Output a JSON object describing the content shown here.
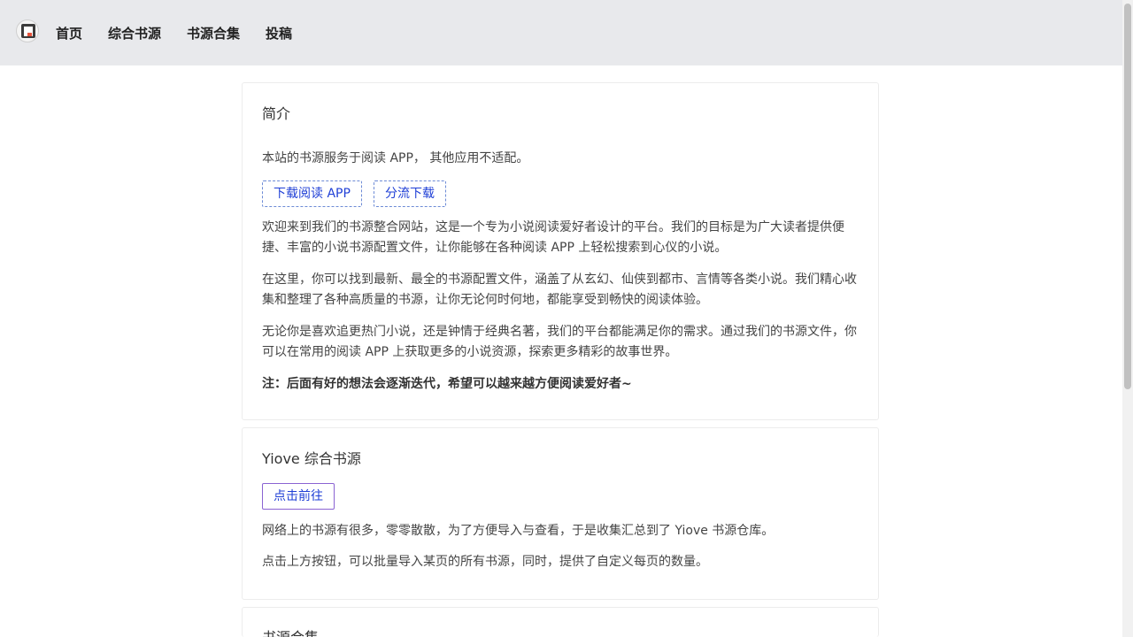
{
  "nav": {
    "logo": "logo-icon",
    "items": [
      {
        "label": "首页"
      },
      {
        "label": "综合书源"
      },
      {
        "label": "书源合集"
      },
      {
        "label": "投稿"
      }
    ]
  },
  "intro": {
    "title": "简介",
    "lead": "本站的书源服务于阅读 APP， 其他应用不适配。",
    "download_button": "下载阅读 APP",
    "mirror_button": "分流下载",
    "p1": "欢迎来到我们的书源整合网站，这是一个专为小说阅读爱好者设计的平台。我们的目标是为广大读者提供便捷、丰富的小说书源配置文件，让你能够在各种阅读 APP 上轻松搜索到心仪的小说。",
    "p2": "在这里，你可以找到最新、最全的书源配置文件，涵盖了从玄幻、仙侠到都市、言情等各类小说。我们精心收集和整理了各种高质量的书源，让你无论何时何地，都能享受到畅快的阅读体验。",
    "p3": "无论你是喜欢追更热门小说，还是钟情于经典名著，我们的平台都能满足你的需求。通过我们的书源文件，你可以在常用的阅读 APP 上获取更多的小说资源，探索更多精彩的故事世界。",
    "note": "注：后面有好的想法会逐渐迭代，希望可以越来越方便阅读爱好者~"
  },
  "yiove": {
    "title": "Yiove 综合书源",
    "go_button": "点击前往",
    "p1": "网络上的书源有很多，零零散散，为了方便导入与查看，于是收集汇总到了 Yiove 书源仓库。",
    "p2": "点击上方按钮，可以批量导入某页的所有书源，同时，提供了自定义每页的数量。"
  },
  "collection": {
    "title": "书源合集"
  }
}
